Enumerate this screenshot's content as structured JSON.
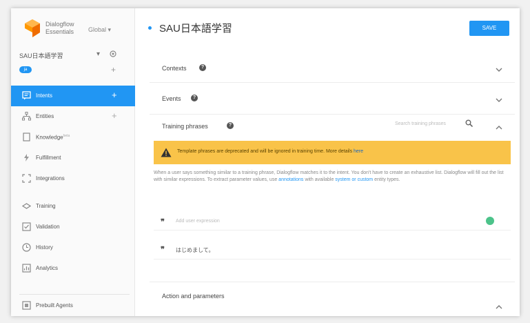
{
  "brand": {
    "name_line1": "Dialogflow",
    "name_line2": "Essentials",
    "region": "Global ▾"
  },
  "agent": {
    "name": "SAU日本語学習",
    "caret": "▾",
    "language_badge": "ja",
    "add": "+"
  },
  "menu": {
    "items": [
      {
        "label": "Intents",
        "icon": "chat-bubble-icon",
        "plus": "+",
        "active": true
      },
      {
        "label": "Entities",
        "icon": "hierarchy-icon",
        "plus": "+"
      },
      {
        "label": "Knowledge",
        "badge": "beta",
        "icon": "document-icon"
      },
      {
        "label": "Fulfillment",
        "icon": "bolt-icon"
      },
      {
        "label": "Integrations",
        "icon": "integrations-icon"
      },
      {
        "label": "Training",
        "icon": "training-icon"
      },
      {
        "label": "Validation",
        "icon": "validation-icon"
      },
      {
        "label": "History",
        "icon": "clock-icon"
      },
      {
        "label": "Analytics",
        "icon": "analytics-icon"
      }
    ],
    "prebuilt": {
      "label": "Prebuilt Agents",
      "icon": "prebuilt-icon"
    }
  },
  "header": {
    "title": "SAU日本語学習",
    "save_label": "SAVE"
  },
  "sections": {
    "contexts": "Contexts",
    "events": "Events",
    "training_phrases": "Training phrases",
    "action_parameters": "Action and parameters"
  },
  "training": {
    "search_placeholder": "Search training phrases",
    "warning_text": "Template phrases are deprecated and will be ignored in training time. More details ",
    "warning_link": "here",
    "desc_part1": "When a user says something similar to a training phrase, Dialogflow matches it to the intent. You don't have to create an exhaustive list. Dialogflow will fill out the list with similar expressions. To extract parameter values, use ",
    "desc_link1": "annotations",
    "desc_part2": " with available ",
    "desc_link2": "system or custom",
    "desc_part3": " entity types.",
    "input_placeholder": "Add user expression",
    "phrases": [
      "はじめまして。"
    ],
    "quote": "❞"
  },
  "colors": {
    "accent": "#2196f3",
    "warning": "#f9c349",
    "status_dot": "#4cc38a"
  }
}
